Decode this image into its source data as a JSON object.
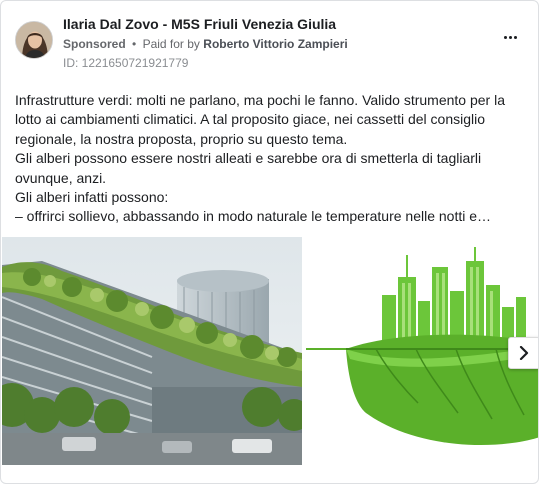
{
  "post": {
    "author": "Ilaria Dal Zovo - M5S Friuli Venezia Giulia",
    "sponsored_label": "Sponsored",
    "separator": "•",
    "paid_for_prefix": "Paid for by",
    "paid_for_name": "Roberto Vittorio Zampieri",
    "ad_id": "ID: 1221650721921779",
    "lines": [
      "Infrastrutture verdi: molti ne parlano, ma pochi le fanno. Valido strumento per la",
      "lotto ai cambiamenti climatici. A tal proposito giace, nei cassetti del consiglio",
      "regionale, la nostra proposta, proprio su questo tema.",
      "Gli alberi possono essere nostri alleati e sarebbe ora di smetterla di tagliarli",
      "ovunque, anzi.",
      "Gli alberi infatti possono:",
      "– offrirci sollievo, abbassando in modo naturale le temperature nelle notti e…"
    ]
  },
  "icons": {
    "more": "more-options-icon",
    "next": "chevron-right-icon"
  },
  "colors": {
    "text": "#1c1e21",
    "secondary": "#65676b",
    "leaf_green": "#5bb02a",
    "city_green": "#6cc63a"
  }
}
